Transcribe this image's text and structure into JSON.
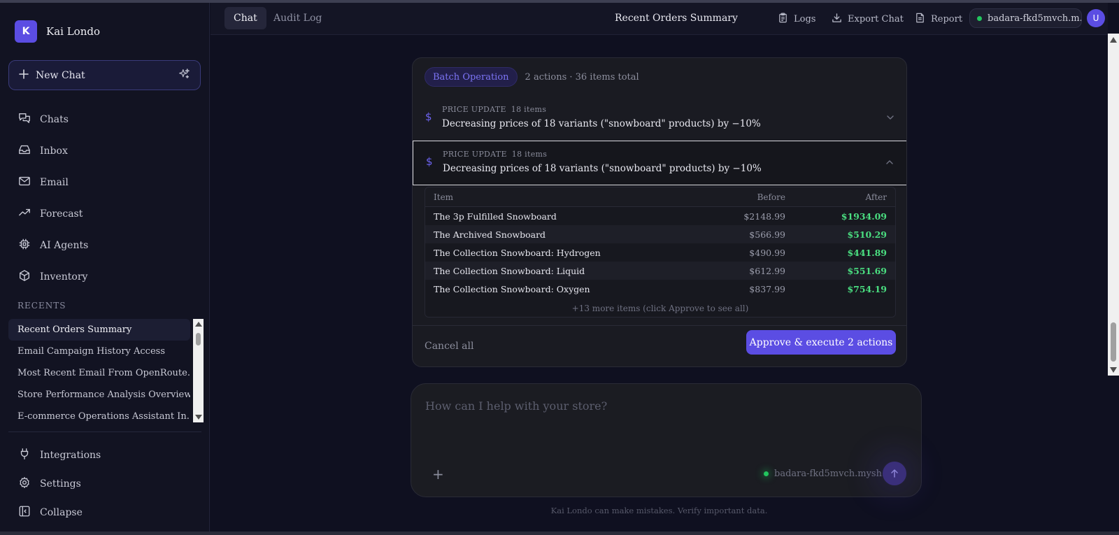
{
  "brand": {
    "logo_letter": "K",
    "name": "Kai Londo"
  },
  "sidebar": {
    "new_chat_label": "New Chat",
    "nav": [
      {
        "label": "Chats",
        "icon": "chat-bubbles-icon"
      },
      {
        "label": "Inbox",
        "icon": "inbox-icon"
      },
      {
        "label": "Email",
        "icon": "mail-icon"
      },
      {
        "label": "Forecast",
        "icon": "trend-up-icon"
      },
      {
        "label": "AI Agents",
        "icon": "cpu-chip-icon"
      },
      {
        "label": "Inventory",
        "icon": "box-icon"
      }
    ],
    "recents_label": "RECENTS",
    "recents": [
      "Recent Orders Summary",
      "Email Campaign History Access",
      "Most Recent Email From OpenRoute...",
      "Store Performance Analysis Overview",
      "E-commerce Operations Assistant In..."
    ],
    "bottom_nav": [
      {
        "label": "Integrations",
        "icon": "plug-icon"
      },
      {
        "label": "Settings",
        "icon": "gear-icon"
      },
      {
        "label": "Collapse",
        "icon": "collapse-icon"
      }
    ]
  },
  "topbar": {
    "tabs": [
      "Chat",
      "Audit Log"
    ],
    "page_title": "Recent Orders Summary",
    "logs_label": "Logs",
    "export_label": "Export Chat",
    "report_label": "Report",
    "store_name": "badara-fkd5mvch.m...",
    "avatar_letter": "U"
  },
  "batch": {
    "badge": "Batch Operation",
    "meta": "2 actions · 36 items total",
    "actions": [
      {
        "kind": "PRICE UPDATE",
        "count": "18 items",
        "description": "Decreasing prices of 18 variants (\"snowboard\" products) by −10%"
      },
      {
        "kind": "PRICE UPDATE",
        "count": "18 items",
        "description": "Decreasing prices of 18 variants (\"snowboard\" products) by −10%"
      }
    ],
    "table": {
      "headers": {
        "item": "Item",
        "before": "Before",
        "after": "After"
      },
      "rows": [
        {
          "item": "The 3p Fulfilled Snowboard",
          "before": "$2148.99",
          "after": "$1934.09"
        },
        {
          "item": "The Archived Snowboard",
          "before": "$566.99",
          "after": "$510.29"
        },
        {
          "item": "The Collection Snowboard: Hydrogen",
          "before": "$490.99",
          "after": "$441.89"
        },
        {
          "item": "The Collection Snowboard: Liquid",
          "before": "$612.99",
          "after": "$551.69"
        },
        {
          "item": "The Collection Snowboard: Oxygen",
          "before": "$837.99",
          "after": "$754.19"
        }
      ],
      "more_note": "+13 more items (click Approve to see all)"
    },
    "cancel_label": "Cancel all",
    "approve_label": "Approve & execute 2 actions"
  },
  "composer": {
    "placeholder": "How can I help with your store?",
    "store_name": "badara-fkd5mvch.mysh..."
  },
  "disclaimer": "Kai Londo can make mistakes. Verify important data.",
  "colors": {
    "accent": "#5b4de3",
    "positive": "#4ade80",
    "online": "#22c55e"
  }
}
